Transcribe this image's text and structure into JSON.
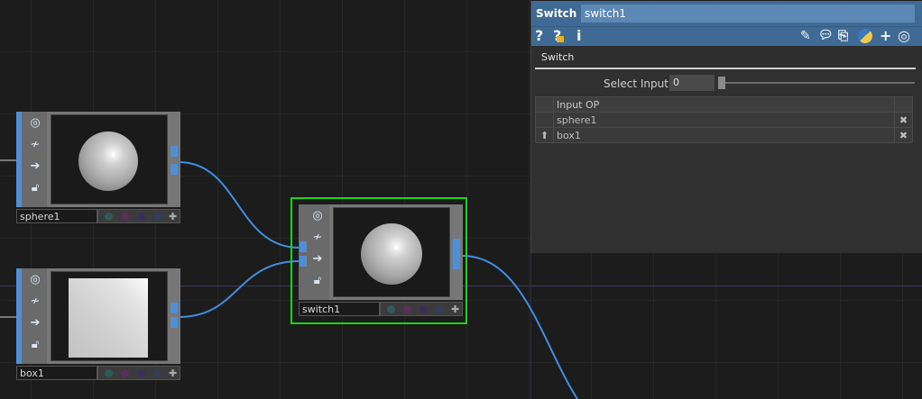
{
  "network": {
    "nodes": [
      {
        "name": "sphere1",
        "preview": "sphere-preview"
      },
      {
        "name": "box1",
        "preview": "box-preview"
      },
      {
        "name": "switch1",
        "preview": "sphere-preview",
        "selected": true
      }
    ],
    "node_icons": [
      "viewer-toggle-icon",
      "cook-icon",
      "bypass-icon",
      "lock-icon"
    ],
    "flag_colors": [
      "#2f5a58",
      "#5a2f5a",
      "#3a2f5a",
      "#2f3f5a"
    ],
    "wire_color": "#3f8ee0",
    "selection_color": "#1ed21e"
  },
  "params": {
    "op_type": "Switch",
    "op_name": "switch1",
    "toolbar": {
      "help": "?",
      "op_help": "?",
      "info": "i"
    },
    "tab": "Switch",
    "select_input_label": "Select Input",
    "select_input_value": "0",
    "table": {
      "header": "Input OP",
      "rows": [
        "sphere1",
        "box1"
      ]
    },
    "colors": {
      "header_bg": "#3f6a95",
      "name_field": "#5b88b4",
      "delete": "#d02424"
    }
  }
}
